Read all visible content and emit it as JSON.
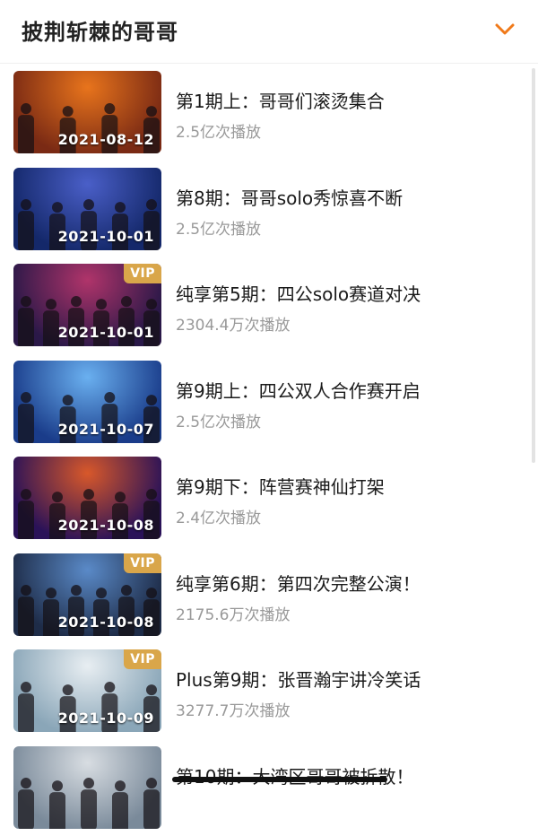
{
  "header": {
    "title": "披荆斩棘的哥哥"
  },
  "episodes": [
    {
      "title": "第1期上：哥哥们滚烫集合",
      "plays": "2.5亿次播放",
      "date": "2021-08-12",
      "vip": "",
      "bg": "#7a2a14",
      "bg2": "#e8741c"
    },
    {
      "title": "第8期：哥哥solo秀惊喜不断",
      "plays": "2.5亿次播放",
      "date": "2021-10-01",
      "vip": "",
      "bg": "#14286a",
      "bg2": "#4a5fc8"
    },
    {
      "title": "纯享第5期：四公solo赛道对决",
      "plays": "2304.4万次播放",
      "date": "2021-10-01",
      "vip": "VIP",
      "bg": "#2a1848",
      "bg2": "#b0346a"
    },
    {
      "title": "第9期上：四公双人合作赛开启",
      "plays": "2.5亿次播放",
      "date": "2021-10-07",
      "vip": "",
      "bg": "#1a3c8a",
      "bg2": "#6ab0f0"
    },
    {
      "title": "第9期下：阵营赛神仙打架",
      "plays": "2.4亿次播放",
      "date": "2021-10-08",
      "vip": "",
      "bg": "#2a1258",
      "bg2": "#d8582a"
    },
    {
      "title": "纯享第6期：第四次完整公演！",
      "plays": "2175.6万次播放",
      "date": "2021-10-08",
      "vip": "VIP",
      "bg": "#1e2c48",
      "bg2": "#5a8ac8"
    },
    {
      "title": "Plus第9期：张晋瀚宇讲冷笑话",
      "plays": "3277.7万次播放",
      "date": "2021-10-09",
      "vip": "VIP",
      "bg": "#8aa6b8",
      "bg2": "#e8eef2"
    },
    {
      "title": "第10期：大湾区哥哥被拆散！",
      "plays": "",
      "date": "",
      "vip": "",
      "bg": "#7a8a9a",
      "bg2": "#d8dde2"
    }
  ],
  "colors": {
    "accent": "#f07a1a",
    "vip_badge": "#d9a64a"
  },
  "icons": {
    "expand": "chevron-down-icon"
  }
}
